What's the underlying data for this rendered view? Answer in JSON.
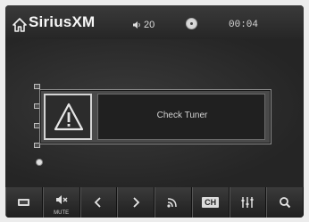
{
  "header": {
    "brand": "SiriusXM",
    "volume": "20",
    "clock": "00:04",
    "icons": [
      "home-icon",
      "volume-icon",
      "disc-icon"
    ]
  },
  "dialog": {
    "message": "Check Tuner",
    "icon": "warning-icon"
  },
  "toolbar": {
    "mute_label": "MUTE",
    "channel_label": "CH",
    "buttons": [
      "source-icon",
      "mute-icon",
      "prev-icon",
      "next-icon",
      "signal-icon",
      "channel-icon",
      "equalizer-icon",
      "search-icon"
    ]
  },
  "colors": {
    "background": "#2b2b2b",
    "text": "#f4f4f4"
  }
}
